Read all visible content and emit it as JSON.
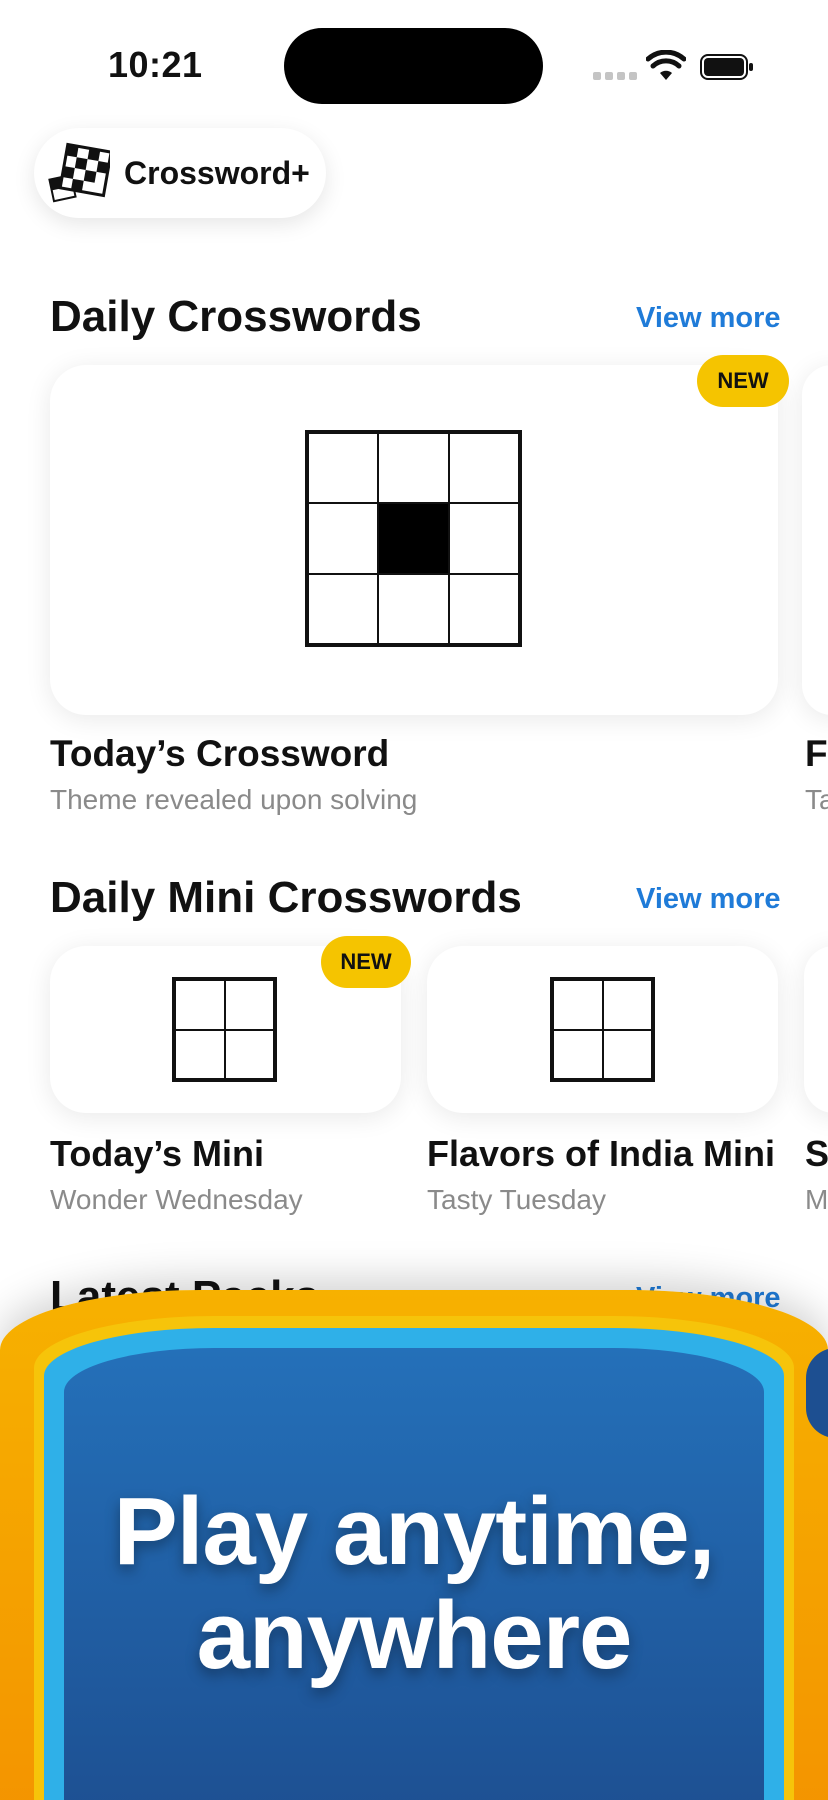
{
  "status_bar": {
    "time": "10:21"
  },
  "app": {
    "name": "Crossword+"
  },
  "sections": {
    "daily": {
      "title": "Daily Crosswords",
      "view_more": "View more",
      "badge": "NEW",
      "items": [
        {
          "title": "Today’s Crossword",
          "subtitle": "Theme revealed upon solving"
        },
        {
          "title": "Fl",
          "subtitle": "Ta"
        }
      ]
    },
    "mini": {
      "title": "Daily Mini Crosswords",
      "view_more": "View more",
      "badge": "NEW",
      "items": [
        {
          "title": "Today’s Mini",
          "subtitle": "Wonder Wednesday"
        },
        {
          "title": "Flavors of India Mini",
          "subtitle": "Tasty Tuesday"
        },
        {
          "title": "Sv",
          "subtitle": "Mu"
        }
      ]
    },
    "packs": {
      "title": "Latest Packs",
      "view_more": "View more"
    }
  },
  "banner": {
    "line1": "Play anytime,",
    "line2": "anywhere"
  },
  "colors": {
    "link": "#1f7bd8",
    "badge": "#f5c400",
    "banner_blue": "#1d4f91",
    "banner_orange": "#f39200"
  }
}
